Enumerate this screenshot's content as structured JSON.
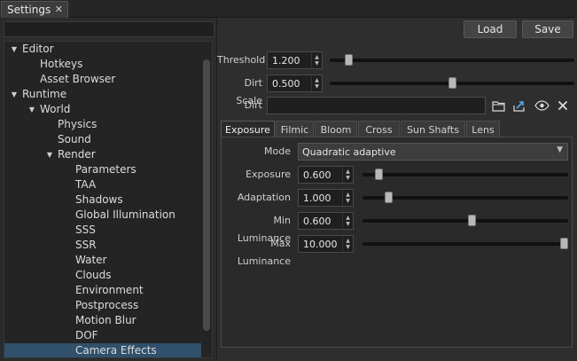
{
  "window": {
    "tab_title": "Settings",
    "tab_close": "✕"
  },
  "sidebar": {
    "search_value": "",
    "items": [
      {
        "label": "Editor",
        "expanded": true
      },
      {
        "label": "Hotkeys"
      },
      {
        "label": "Asset Browser"
      },
      {
        "label": "Runtime",
        "expanded": true
      },
      {
        "label": "World",
        "expanded": true
      },
      {
        "label": "Physics"
      },
      {
        "label": "Sound"
      },
      {
        "label": "Render",
        "expanded": true
      },
      {
        "label": "Parameters"
      },
      {
        "label": "TAA"
      },
      {
        "label": "Shadows"
      },
      {
        "label": "Global Illumination"
      },
      {
        "label": "SSS"
      },
      {
        "label": "SSR"
      },
      {
        "label": "Water"
      },
      {
        "label": "Clouds"
      },
      {
        "label": "Environment"
      },
      {
        "label": "Postprocess"
      },
      {
        "label": "Motion Blur"
      },
      {
        "label": "DOF"
      },
      {
        "label": "Camera Effects",
        "selected": true
      }
    ]
  },
  "toolbar": {
    "load_label": "Load",
    "save_label": "Save"
  },
  "params": {
    "threshold": {
      "label": "Threshold",
      "value": "1.200",
      "level": 0.06
    },
    "dirt_scale": {
      "label": "Dirt Scale",
      "value": "0.500",
      "level": 0.5
    },
    "dirt": {
      "label": "Dirt",
      "value": ""
    }
  },
  "icons": {
    "folder": "folder-icon",
    "export": "export-icon",
    "eye": "eye-icon",
    "clear": "close-icon"
  },
  "tabs": [
    {
      "label": "Exposure",
      "active": true
    },
    {
      "label": "Filmic"
    },
    {
      "label": "Bloom"
    },
    {
      "label": "Cross"
    },
    {
      "label": "Sun Shafts"
    },
    {
      "label": "Lens"
    }
  ],
  "exposure": {
    "mode": {
      "label": "Mode",
      "value": "Quadratic adaptive"
    },
    "exposure": {
      "label": "Exposure",
      "value": "0.600",
      "level": 0.06
    },
    "adaptation": {
      "label": "Adaptation",
      "value": "1.000",
      "level": 0.11
    },
    "min_luminance": {
      "label": "Min Luminance",
      "value": "0.600",
      "level": 0.53
    },
    "max_luminance": {
      "label": "Max Luminance",
      "value": "10.000",
      "level": 1.0
    }
  },
  "colors": {
    "selection": "#30506b",
    "background": "#2b2b2b",
    "accent_text": "#d8d8d8"
  }
}
